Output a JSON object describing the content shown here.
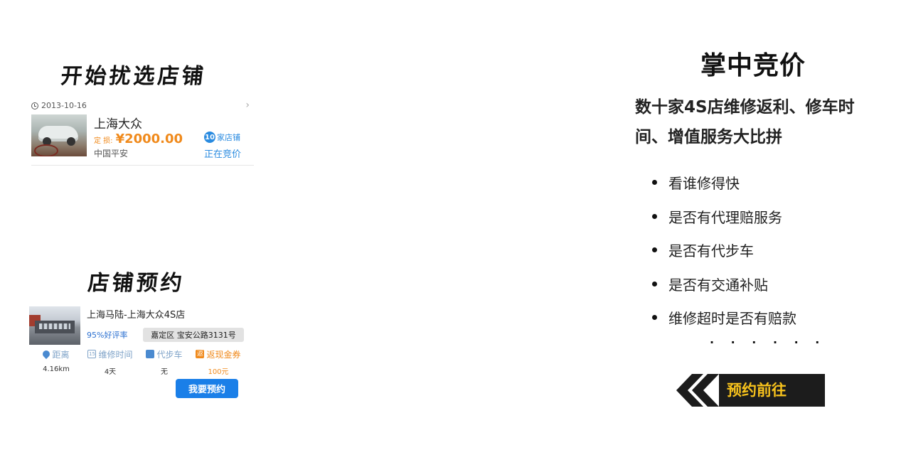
{
  "left": {
    "heading_bidding": "开始扰选店铺",
    "bid_card": {
      "date": "2013-10-16",
      "store_name": "上海大众",
      "deposit_label": "定 损:",
      "deposit_value": "¥2000.00",
      "insurer": "中国平安",
      "store_count": "10",
      "store_count_unit": "家店铺",
      "status": "正在竞价"
    },
    "heading_booking": "店铺预约",
    "booking_card": {
      "store_name": "上海马陆-上海大众4S店",
      "rating": "95%好评率",
      "address": "嘉定区 宝安公路3131号",
      "metrics": [
        {
          "icon": "location-pin-icon",
          "label": "距离",
          "value": "4.16km"
        },
        {
          "icon": "calendar-icon",
          "label": "维修时间",
          "value": "4天"
        },
        {
          "icon": "car-icon",
          "label": "代步车",
          "value": "无"
        },
        {
          "icon": "cashback-icon",
          "label": "返现金券",
          "value": "100元"
        }
      ],
      "calendar_icon_glyph": "15",
      "cashback_icon_glyph": "返",
      "book_button": "我要预约"
    }
  },
  "right": {
    "title": "掌中竞价",
    "description": "数十家4S店维修返利、修车时间、增值服务大比拼",
    "features": [
      "看谁修得快",
      "是否有代理赔服务",
      "是否有代步车",
      "是否有交通补贴",
      "维修超时是否有赔款"
    ],
    "ellipsis": "· · · · · ·",
    "cta": "预约前往"
  },
  "colors": {
    "accent_blue": "#2a8be0",
    "button_blue": "#1a7fe8",
    "price_orange": "#f08a1c",
    "cta_yellow": "#f7c21c",
    "cta_black": "#1c1c1c"
  }
}
